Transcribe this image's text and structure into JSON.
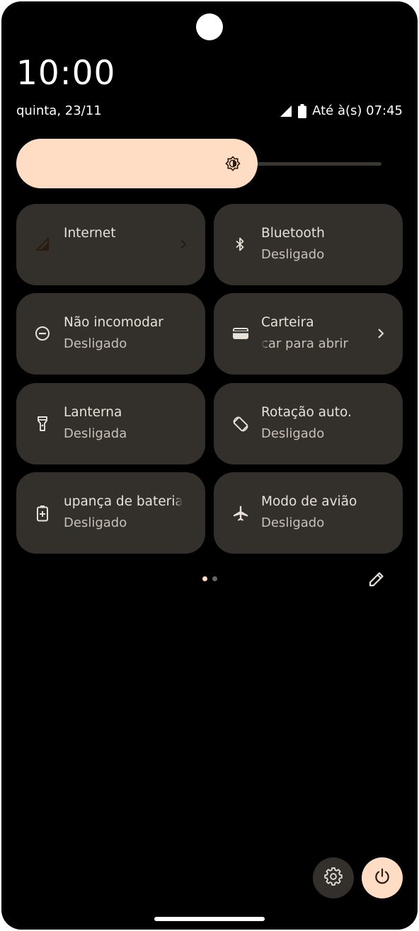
{
  "header": {
    "time": "10:00",
    "date": "quinta, 23/11",
    "battery_text": "Até à(s) 07:45",
    "icons": [
      "signal-icon",
      "battery-icon"
    ]
  },
  "brightness": {
    "level": 0.66,
    "icon": "brightness-icon"
  },
  "tiles": [
    {
      "label": "Internet",
      "sub": "",
      "icon": "cellular-signal-icon",
      "active": true,
      "chevron": true
    },
    {
      "label": "Bluetooth",
      "sub": "Desligado",
      "icon": "bluetooth-icon",
      "active": false,
      "chevron": false
    },
    {
      "label": "Não incomodar",
      "sub": "Desligado",
      "icon": "do-not-disturb-icon",
      "active": false,
      "chevron": false
    },
    {
      "label": "Carteira",
      "sub": "car para abrir",
      "icon": "wallet-icon",
      "active": false,
      "chevron": true
    },
    {
      "label": "Lanterna",
      "sub": "Desligada",
      "icon": "flashlight-icon",
      "active": false,
      "chevron": false
    },
    {
      "label": "Rotação auto.",
      "sub": "Desligado",
      "icon": "auto-rotate-icon",
      "active": false,
      "chevron": false
    },
    {
      "label": "upança de bateria",
      "sub": "Desligado",
      "icon": "battery-saver-icon",
      "active": false,
      "chevron": false
    },
    {
      "label": "Modo de avião",
      "sub": "Desligado",
      "icon": "airplane-icon",
      "active": false,
      "chevron": false
    }
  ],
  "pager": {
    "pages": 2,
    "current": 1
  },
  "colors": {
    "accent": "#ffdcc4",
    "tile_bg": "#332f2b",
    "background": "#000000",
    "dot_inactive": "#6b6560"
  },
  "actions": {
    "edit_icon": "pencil-icon",
    "settings_icon": "gear-icon",
    "power_icon": "power-icon"
  }
}
